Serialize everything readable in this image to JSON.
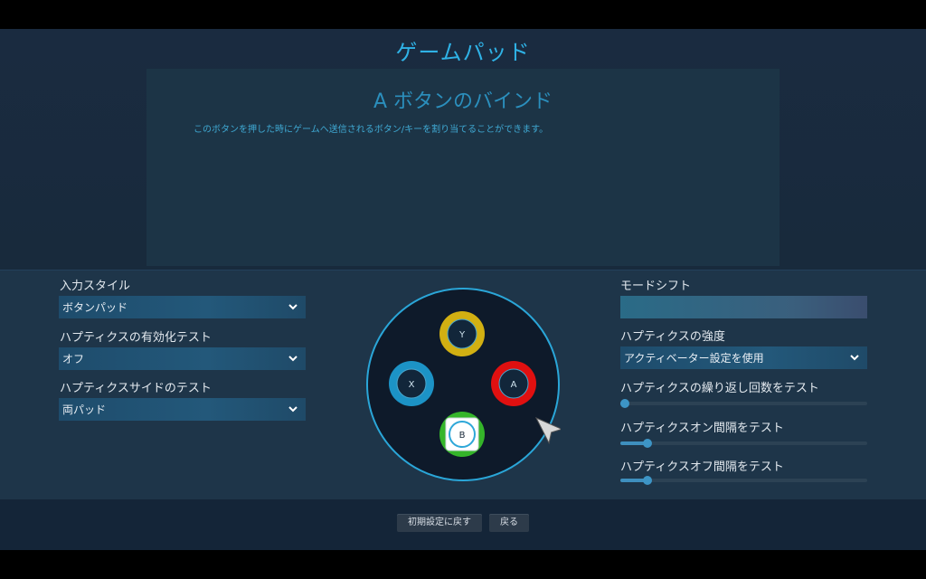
{
  "header": {
    "title": "ゲームパッド"
  },
  "binding": {
    "title": "A ボタンのバインド",
    "description": "このボタンを押した時にゲームへ送信されるボタン/キーを割り当てることができます。"
  },
  "left_settings": {
    "input_style": {
      "label": "入力スタイル",
      "value": "ボタンパッド"
    },
    "haptics_enable_test": {
      "label": "ハプティクスの有効化テスト",
      "value": "オフ"
    },
    "haptics_side_test": {
      "label": "ハプティクスサイドのテスト",
      "value": "両パッド"
    }
  },
  "pad": {
    "buttons": {
      "y": {
        "label": "Y",
        "color": "#d2b012"
      },
      "x": {
        "label": "X",
        "color": "#1c93c6"
      },
      "a": {
        "label": "A",
        "color": "#e01010"
      },
      "b": {
        "label": "B",
        "color": "#35b52a"
      }
    },
    "selected": "A"
  },
  "right_settings": {
    "mode_shift": {
      "label": "モードシフト",
      "value": ""
    },
    "haptics_strength": {
      "label": "ハプティクスの強度",
      "value": "アクティベーター設定を使用"
    },
    "repeat_count_test": {
      "label": "ハプティクスの繰り返し回数をテスト",
      "level": 0.0
    },
    "on_interval_test": {
      "label": "ハプティクスオン間隔をテスト",
      "level": 0.11
    },
    "off_interval_test": {
      "label": "ハプティクスオフ間隔をテスト",
      "level": 0.11
    }
  },
  "footer": {
    "reset_label": "初期設定に戻す",
    "back_label": "戻る"
  },
  "icons": {
    "dropdown": "chevron-down-icon",
    "cursor": "mouse-pointer-icon"
  },
  "colors": {
    "accent": "#2fb2e6",
    "background": "#1a2b40"
  }
}
